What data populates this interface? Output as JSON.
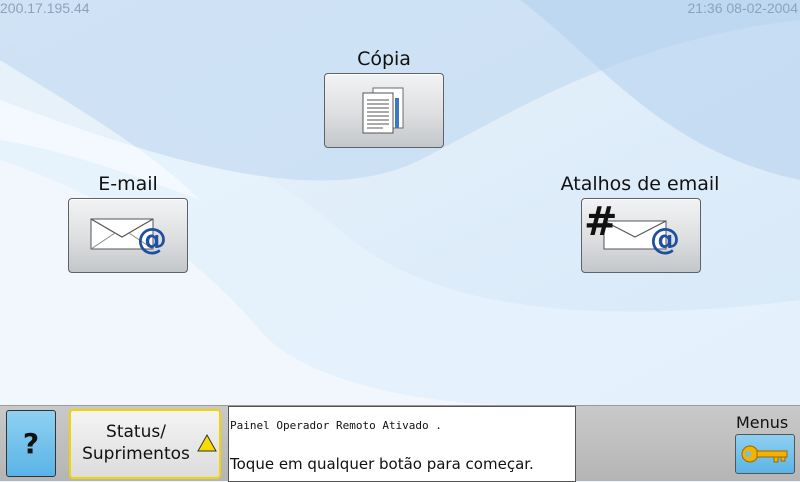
{
  "topbar": {
    "ip": "200.17.195.44",
    "datetime": "21:36 08-02-2004"
  },
  "tiles": {
    "copy": {
      "label": "Cópia",
      "icon": "copy-documents-icon"
    },
    "email": {
      "label": "E-mail",
      "icon": "email-envelope-icon"
    },
    "email_shortcuts": {
      "label": "Atalhos de email",
      "icon": "email-shortcut-icon"
    }
  },
  "bottombar": {
    "help_label": "?",
    "status_line1": "Status/",
    "status_line2": "Suprimentos",
    "message_line1": "Painel Operador Remoto Ativado .",
    "message_line2": "Toque em qualquer botão para começar.",
    "menus_label": "Menus",
    "menus_icon": "key-icon",
    "warning_icon": "warning-triangle-icon"
  },
  "colors": {
    "background": "#e7f1fb",
    "help_button": "#6fc1ec",
    "status_border": "#f2d500"
  }
}
